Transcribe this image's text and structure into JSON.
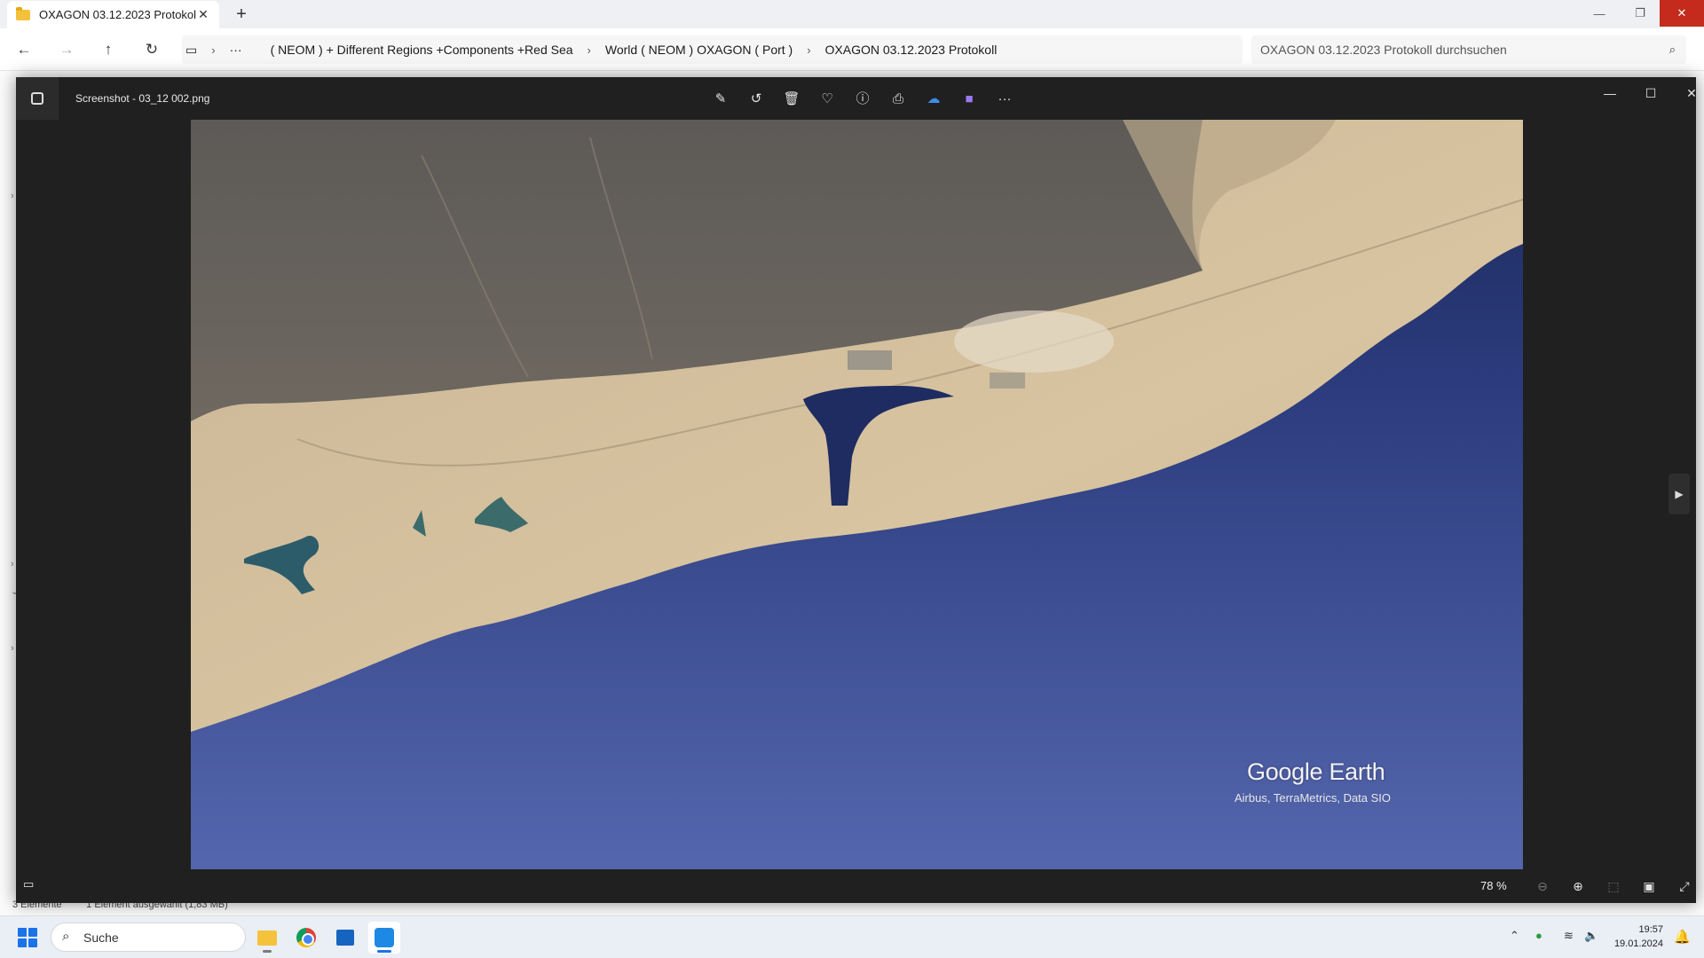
{
  "explorer": {
    "tab_title": "OXAGON 03.12.2023 Protokoll",
    "breadcrumbs": [
      "( NEOM ) + Different Regions +Components +Red Sea",
      "World ( NEOM ) OXAGON ( Port )",
      "OXAGON 03.12.2023 Protokoll"
    ],
    "overflow_label": "···",
    "search_placeholder": "OXAGON 03.12.2023 Protokoll durchsuchen",
    "status_items": "3 Elemente",
    "status_selected": "1 Element ausgewählt (1,83 MB)"
  },
  "viewer": {
    "file_name": "Screenshot - 03_12 002.png",
    "zoom": "78 %",
    "image": {
      "brand": "Google Earth",
      "credit": "Airbus, TerraMetrics, Data SIO"
    },
    "toolbar_icons": [
      "edit-image-icon",
      "rotate-icon",
      "delete-icon",
      "favorite-icon",
      "info-icon",
      "print-icon",
      "onedrive-icon",
      "clipchamp-icon",
      "more-icon"
    ]
  },
  "taskbar": {
    "search_label": "Suche",
    "time": "19:57",
    "date": "19.01.2024"
  },
  "colors": {
    "accent": "#1a73e8",
    "close_red": "#c42b1c",
    "viewer_bg": "#202020"
  }
}
